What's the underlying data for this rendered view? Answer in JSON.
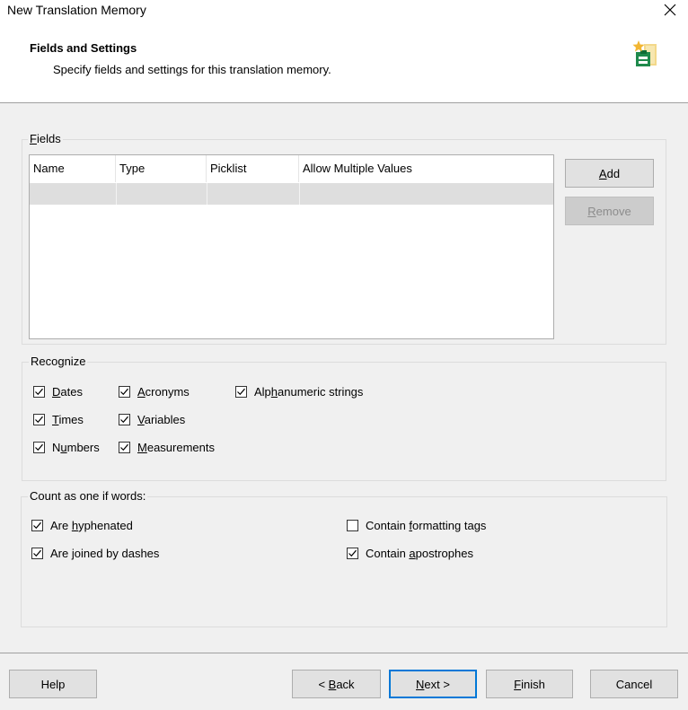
{
  "window": {
    "title": "New Translation Memory",
    "close_icon": "close-icon"
  },
  "header": {
    "title": "Fields and Settings",
    "subtitle": "Specify fields and settings for this translation memory.",
    "icon": "translation-memory-icon"
  },
  "fields": {
    "group_label_pre": "",
    "group_label_mnemonic": "F",
    "group_label_post": "ields",
    "columns": [
      "Name",
      "Type",
      "Picklist",
      "Allow Multiple Values"
    ],
    "add_pre": "",
    "add_mn": "A",
    "add_post": "dd",
    "remove_pre": "",
    "remove_mn": "R",
    "remove_post": "emove"
  },
  "recognize": {
    "label": "Recognize",
    "items": [
      {
        "pre": "",
        "mn": "D",
        "post": "ates",
        "checked": true
      },
      {
        "pre": "",
        "mn": "A",
        "post": "cronyms",
        "checked": true
      },
      {
        "pre": "Alp",
        "mn": "h",
        "post": "anumeric strings",
        "checked": true
      },
      {
        "pre": "",
        "mn": "T",
        "post": "imes",
        "checked": true
      },
      {
        "pre": "",
        "mn": "V",
        "post": "ariables",
        "checked": true
      },
      {
        "pre": "N",
        "mn": "u",
        "post": "mbers",
        "checked": true
      },
      {
        "pre": "",
        "mn": "M",
        "post": "easurements",
        "checked": true
      }
    ]
  },
  "count": {
    "label": "Count as one if words:",
    "items": [
      {
        "pre": "Are ",
        "mn": "h",
        "post": "yphenated",
        "checked": true
      },
      {
        "pre": "Are ",
        "mn": "j",
        "post": "oined by dashes",
        "checked": true
      },
      {
        "pre": "Contain ",
        "mn": "f",
        "post": "ormatting tags",
        "checked": false
      },
      {
        "pre": "Contain ",
        "mn": "a",
        "post": "postrophes",
        "checked": true
      }
    ]
  },
  "footer": {
    "help": "Help",
    "back_pre": "< ",
    "back_mn": "B",
    "back_post": "ack",
    "next_pre": "",
    "next_mn": "N",
    "next_post": "ext >",
    "finish_pre": "",
    "finish_mn": "F",
    "finish_post": "inish",
    "cancel": "Cancel"
  }
}
